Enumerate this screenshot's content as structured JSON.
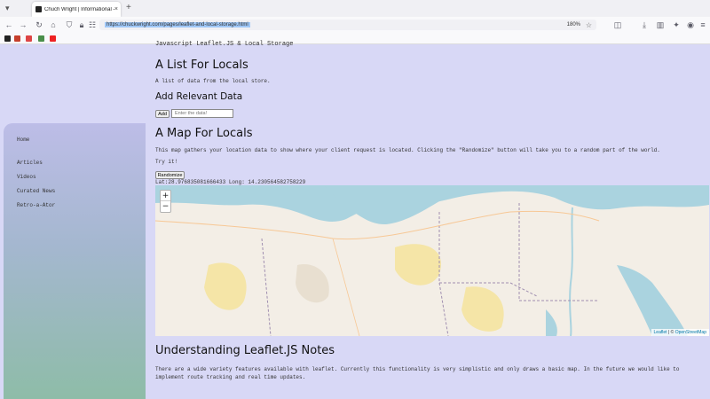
{
  "browser": {
    "tab_title": "Chuch Wright | Informational –",
    "tab_close": "×",
    "new_tab": "+",
    "url": "https://chuckwright.com/pages/leaflet-and-local-storage.html",
    "zoom": "180%"
  },
  "page": {
    "top_clipped": "Javascript Leaflet.JS & Local Storage",
    "list_heading": "A List For Locals",
    "list_desc": "A list of data from the local store.",
    "add_heading": "Add Relevant Data",
    "add_button": "Add",
    "add_placeholder": "Enter the data!",
    "map_heading": "A Map For Locals",
    "map_desc": "This map gathers your location data to show where your client request is located. Clicking the \"Randomize\" button will take you to a random part of the world.",
    "try_it": "Try it!",
    "randomize_button": "Randomize",
    "coords": "Lat:28.976835081666433 Long: 14.230564582758229",
    "notes_heading": "Understanding Leaflet.JS Notes",
    "notes_desc": "There are a wide variety features available with leaflet. Currently this functionality is very simplistic and only draws a basic map. In the future we would like to implement route tracking and real time updates."
  },
  "sidebar": {
    "items": [
      "Home",
      "Articles",
      "Videos",
      "Curated News",
      "Retro-a-Ator"
    ]
  },
  "map": {
    "zoom_in": "+",
    "zoom_out": "−",
    "attribution_leaflet": "Leaflet",
    "attribution_sep": " | © ",
    "attribution_osm": "OpenStreetMap",
    "colors": {
      "land": "#f3eee6",
      "sea": "#aad3df",
      "desert": "#f5e39b",
      "border": "#a08fb0"
    }
  }
}
